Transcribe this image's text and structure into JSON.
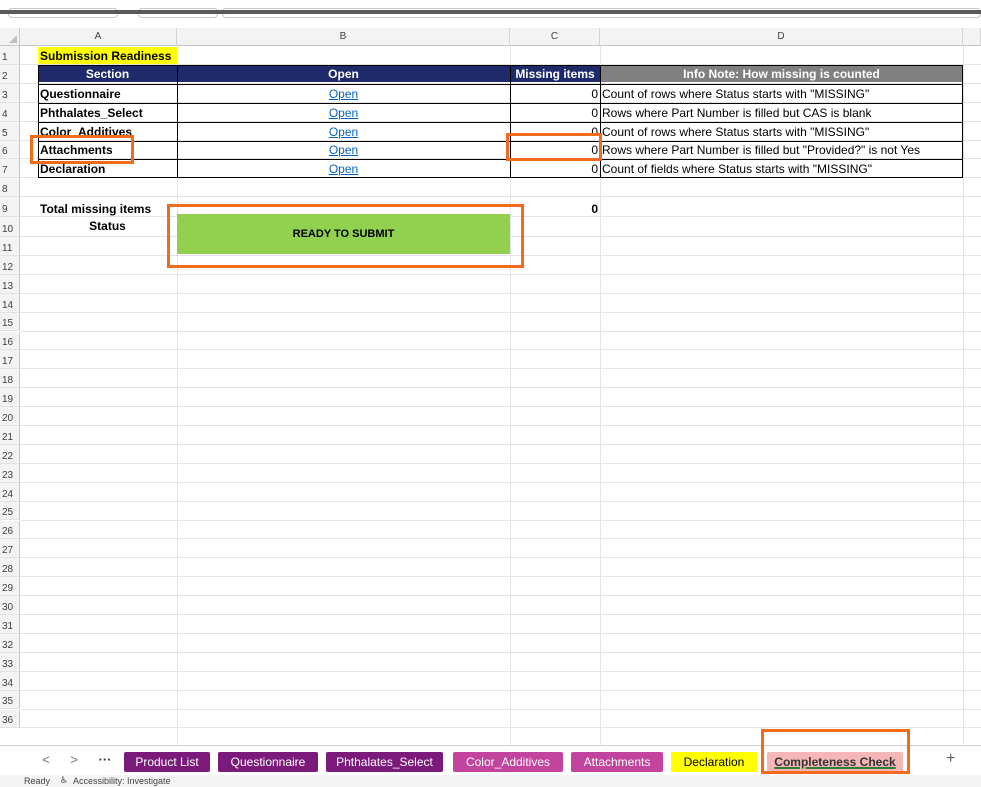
{
  "columns": [
    "A",
    "B",
    "C",
    "D"
  ],
  "row_numbers": [
    "1",
    "2",
    "3",
    "4",
    "5",
    "6",
    "7",
    "8",
    "9",
    "10",
    "11",
    "12",
    "13",
    "14",
    "15",
    "16",
    "17",
    "18",
    "19",
    "20",
    "21",
    "22",
    "23",
    "24",
    "25",
    "26",
    "27",
    "28",
    "29",
    "30",
    "31",
    "32",
    "33",
    "34",
    "35",
    "36"
  ],
  "title": "Submission Readiness",
  "headers": {
    "section": "Section",
    "open": "Open",
    "missing": "Missing items",
    "info": "Info Note: How missing is counted"
  },
  "rows": [
    {
      "section": "Questionnaire",
      "open": "Open",
      "missing": "0",
      "info": "Count of rows where Status starts with \"MISSING\""
    },
    {
      "section": "Phthalates_Select",
      "open": "Open",
      "missing": "0",
      "info": "Rows where Part Number is filled but CAS is blank"
    },
    {
      "section": "Color_Additives",
      "open": "Open",
      "missing": "0",
      "info": "Count of rows where Status starts with \"MISSING\""
    },
    {
      "section": "Attachments",
      "open": "Open",
      "missing": "0",
      "info": "Rows where Part Number is filled but \"Provided?\" is not Yes"
    },
    {
      "section": "Declaration",
      "open": "Open",
      "missing": "0",
      "info": "Count of fields where Status starts with \"MISSING\""
    }
  ],
  "total": {
    "label": "Total missing items",
    "value": "0"
  },
  "status": {
    "label": "Status",
    "value": "READY TO SUBMIT"
  },
  "tabs": [
    {
      "label": "Product List",
      "color": "#7b1a7b"
    },
    {
      "label": "Questionnaire",
      "color": "#7b1a7b"
    },
    {
      "label": "Phthalates_Select",
      "color": "#7b1a7b"
    },
    {
      "label": "Color_Additives",
      "color": "#c2449e"
    },
    {
      "label": "Attachments",
      "color": "#c2449e"
    },
    {
      "label": "Declaration",
      "color": "#ffff00"
    },
    {
      "label": "Completeness Check",
      "color": "#f4b6b6"
    }
  ],
  "nav": {
    "prev": "<",
    "next": ">",
    "more": "···",
    "add": "+"
  },
  "statusbar": {
    "ready": "Ready",
    "accessibility": "Accessibility: Investigate"
  },
  "colors": {
    "title_bg": "#ffff00",
    "header_bg": "#1f2a6b",
    "info_header_bg": "#808080",
    "status_bg": "#92d050",
    "highlight": "#f26a1b"
  }
}
